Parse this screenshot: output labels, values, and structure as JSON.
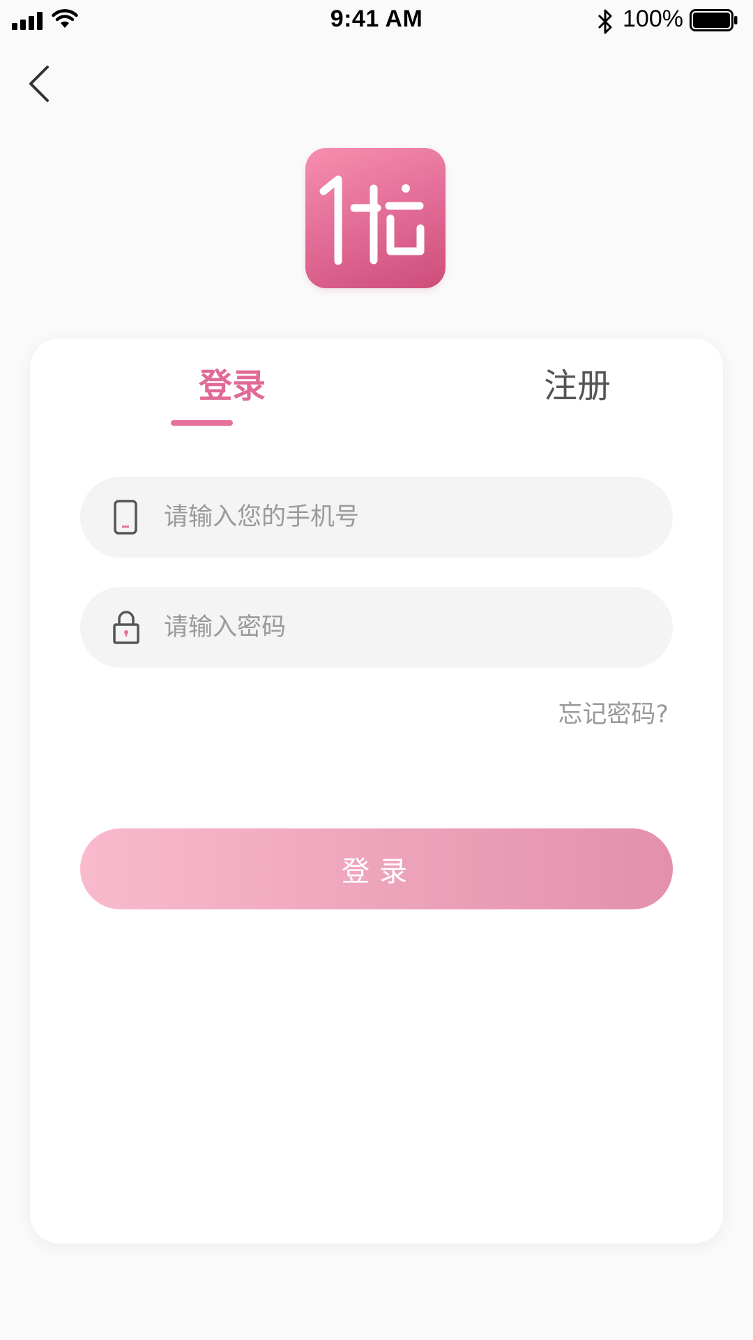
{
  "status_bar": {
    "time": "9:41 AM",
    "battery_percent": "100%",
    "icons": [
      "cellular-signal-icon",
      "wifi-icon",
      "bluetooth-icon",
      "battery-icon"
    ]
  },
  "nav": {
    "back_icon": "chevron-left-icon"
  },
  "logo": {
    "icon": "app-logo-icon",
    "colors": [
      "#f68fae",
      "#ce4d7a"
    ]
  },
  "tabs": [
    {
      "label": "登录",
      "active": true
    },
    {
      "label": "注册",
      "active": false
    }
  ],
  "form": {
    "phone": {
      "placeholder": "请输入您的手机号",
      "value": "",
      "icon": "phone-icon"
    },
    "password": {
      "placeholder": "请输入密码",
      "value": "",
      "icon": "lock-icon"
    },
    "forgot_label": "忘记密码?",
    "submit_label": "登录"
  },
  "colors": {
    "accent": "#e5709b",
    "button_gradient_start": "#f9bacd",
    "button_gradient_end": "#e390ac",
    "background": "#fafafa",
    "input_bg": "#f4f4f4"
  }
}
